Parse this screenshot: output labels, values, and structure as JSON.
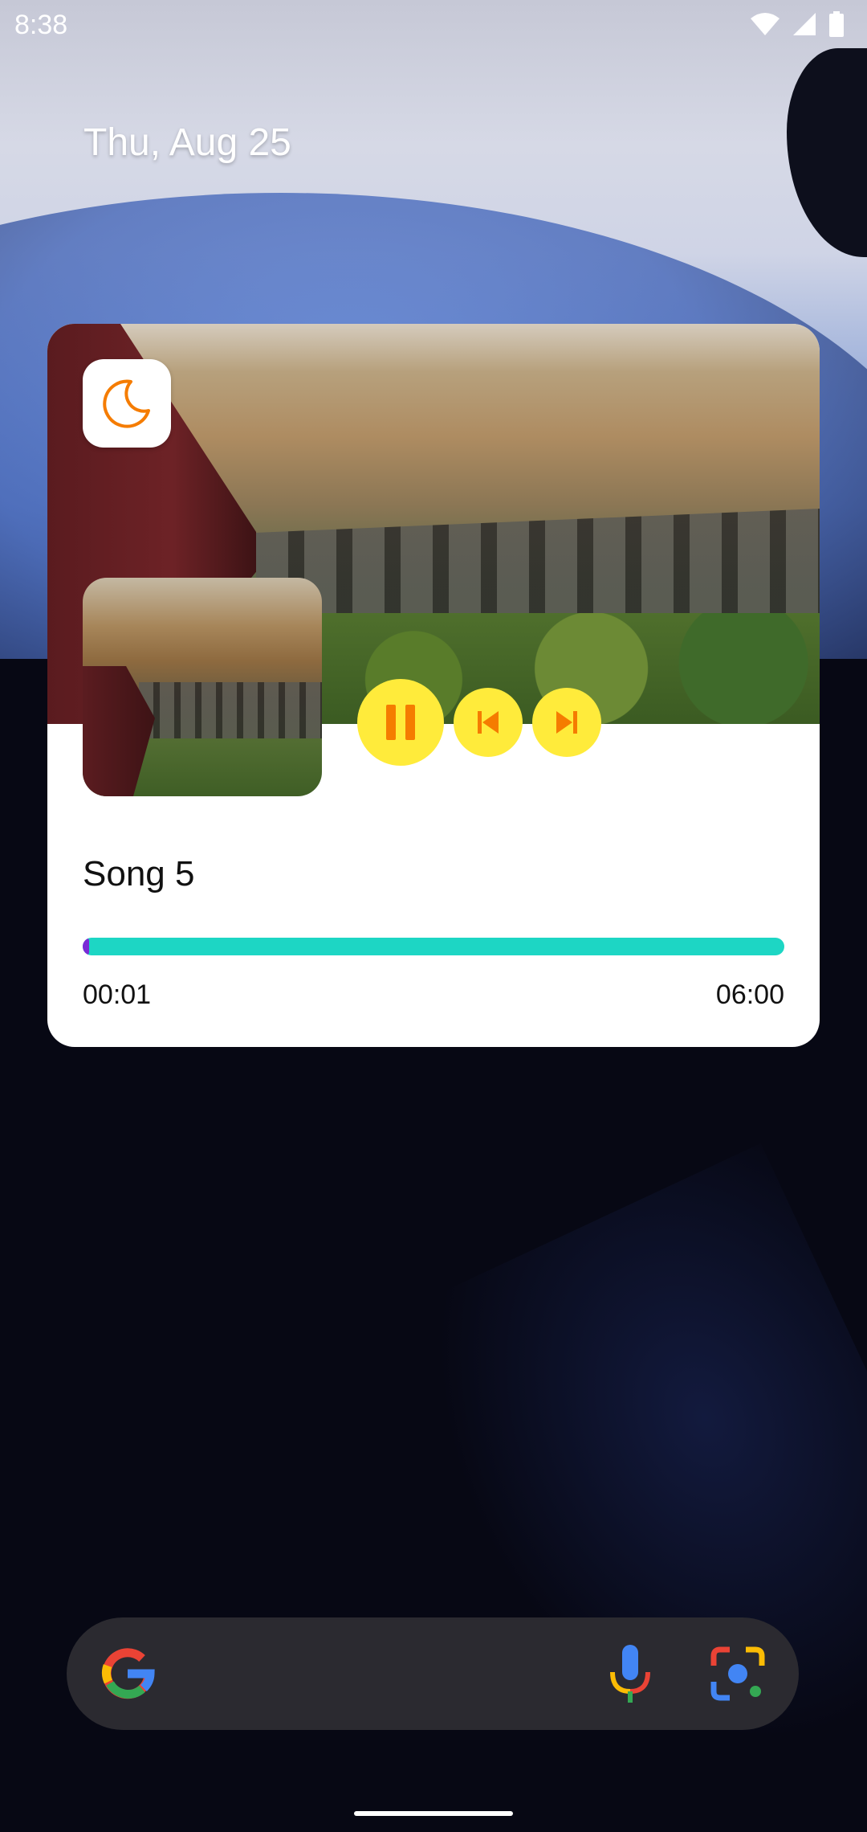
{
  "status_bar": {
    "time": "8:38",
    "icons": [
      "wifi-icon",
      "signal-icon",
      "battery-icon"
    ]
  },
  "date_text": "Thu, Aug 25",
  "widget": {
    "app_icon": "moon-icon",
    "accent_color": "#ffeb3b",
    "icon_color": "#f57c00",
    "controls": [
      "pause-icon",
      "skip-previous-icon",
      "skip-next-icon"
    ],
    "song_title": "Song 5",
    "time_current": "00:01",
    "time_total": "06:00",
    "progress_fraction": 0.003,
    "progress_color": "#1dd6c4"
  },
  "search_bar": {
    "icons": [
      "google-icon",
      "microphone-icon",
      "lens-icon"
    ]
  }
}
